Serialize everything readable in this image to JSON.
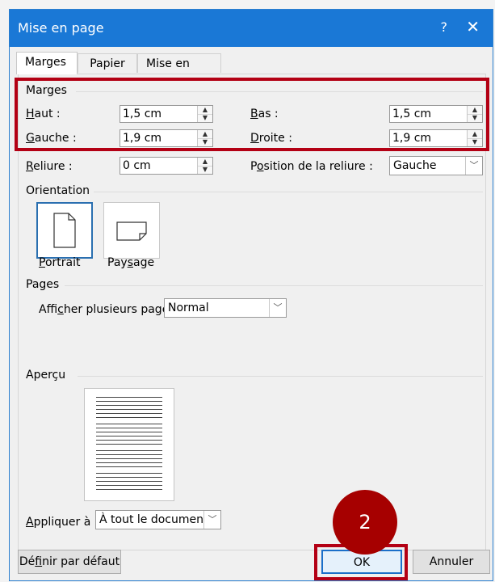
{
  "window": {
    "title": "Mise en page",
    "help_glyph": "?",
    "close_glyph": "✕"
  },
  "tabs": [
    {
      "label": "Marges",
      "active": true
    },
    {
      "label": "Papier",
      "active": false
    },
    {
      "label": "Mise en page",
      "active": false
    }
  ],
  "marges": {
    "section_title": "Marges",
    "haut": {
      "label_u": "H",
      "label_rest": "aut :",
      "value": "1,5 cm"
    },
    "bas": {
      "label_u": "B",
      "label_rest": "as :",
      "value": "1,5 cm"
    },
    "gauche": {
      "label_u": "G",
      "label_rest": "auche :",
      "value": "1,9 cm"
    },
    "droite": {
      "label_u": "D",
      "label_rest": "roite :",
      "value": "1,9 cm"
    },
    "reliure": {
      "label_u": "R",
      "label_rest": "eliure :",
      "value": "0 cm"
    },
    "position_reliure": {
      "label_pre": "P",
      "label_u": "o",
      "label_rest": "sition de la reliure :",
      "value": "Gauche"
    }
  },
  "orientation": {
    "section_title": "Orientation",
    "portrait": {
      "label_u": "P",
      "label_rest": "ortrait"
    },
    "paysage": {
      "label_pre": "Pay",
      "label_u": "s",
      "label_rest": "age"
    }
  },
  "pages": {
    "section_title": "Pages",
    "label_pre": "Affi",
    "label_u": "c",
    "label_rest": "her plusieurs pages :",
    "value": "Normal"
  },
  "apercu": {
    "section_title": "Aperçu"
  },
  "appliquer": {
    "label_u": "A",
    "label_rest": "ppliquer à :",
    "value": "À tout le document"
  },
  "buttons": {
    "definir": {
      "label_pre": "Dé",
      "label_u": "f",
      "label_rest": "inir par défaut"
    },
    "ok": "OK",
    "annuler": "Annuler"
  },
  "annotation": {
    "step_number": "2",
    "color": "#a60000"
  },
  "colors": {
    "titlebar": "#1a78d6",
    "highlight": "#b30014"
  }
}
